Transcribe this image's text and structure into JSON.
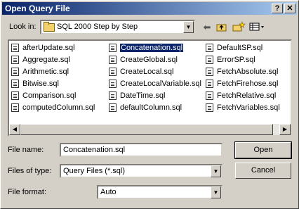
{
  "window": {
    "title": "Open Query File",
    "help_label": "?",
    "close_label": "✕"
  },
  "lookin": {
    "label": "Look in:",
    "value": "SQL 2000 Step by Step"
  },
  "toolbar": {
    "back_icon": "back-arrow-icon",
    "up_icon": "up-folder-icon",
    "new_icon": "new-folder-icon",
    "views_icon": "views-menu-icon"
  },
  "files": {
    "col1": [
      "afterUpdate.sql",
      "Aggregate.sql",
      "Arithmetic.sql",
      "Bitwise.sql",
      "Comparison.sql",
      "computedColumn.sql"
    ],
    "col2": [
      "Concatenation.sql",
      "CreateGlobal.sql",
      "CreateLocal.sql",
      "CreateLocalVariable.sql",
      "DateTime.sql",
      "defaultColumn.sql"
    ],
    "col3": [
      "DefaultSP.sql",
      "ErrorSP.sql",
      "FetchAbsolute.sql",
      "FetchFirehose.sql",
      "FetchRelative.sql",
      "FetchVariables.sql"
    ],
    "selected": "Concatenation.sql"
  },
  "form": {
    "filename_label": "File name:",
    "filename_value": "Concatenation.sql",
    "filetype_label": "Files of type:",
    "filetype_value": "Query Files (*.sql)",
    "fileformat_label": "File format:",
    "fileformat_value": "Auto"
  },
  "buttons": {
    "open": "Open",
    "cancel": "Cancel"
  }
}
